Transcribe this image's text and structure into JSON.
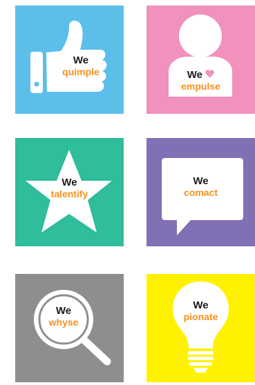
{
  "colors": {
    "orange": "#f7901e",
    "tile_blue": "#5bbfe9",
    "tile_pink": "#f191bd",
    "tile_teal": "#2fbd9b",
    "tile_purple": "#8170b3",
    "tile_gray": "#8d8e90",
    "tile_yellow": "#fff200",
    "heart": "#f191bd"
  },
  "tiles": [
    {
      "we": "We",
      "verb": "quimple",
      "icon": "thumbs-up-icon"
    },
    {
      "we": "We",
      "verb": "empulse",
      "icon": "person-icon"
    },
    {
      "we": "We",
      "verb": "talentify",
      "icon": "star-icon"
    },
    {
      "we": "We",
      "verb": "comact",
      "icon": "speech-bubble-icon"
    },
    {
      "we": "We",
      "verb": "whyse",
      "icon": "magnifier-icon"
    },
    {
      "we": "We",
      "verb": "pionate",
      "icon": "lightbulb-icon"
    }
  ]
}
